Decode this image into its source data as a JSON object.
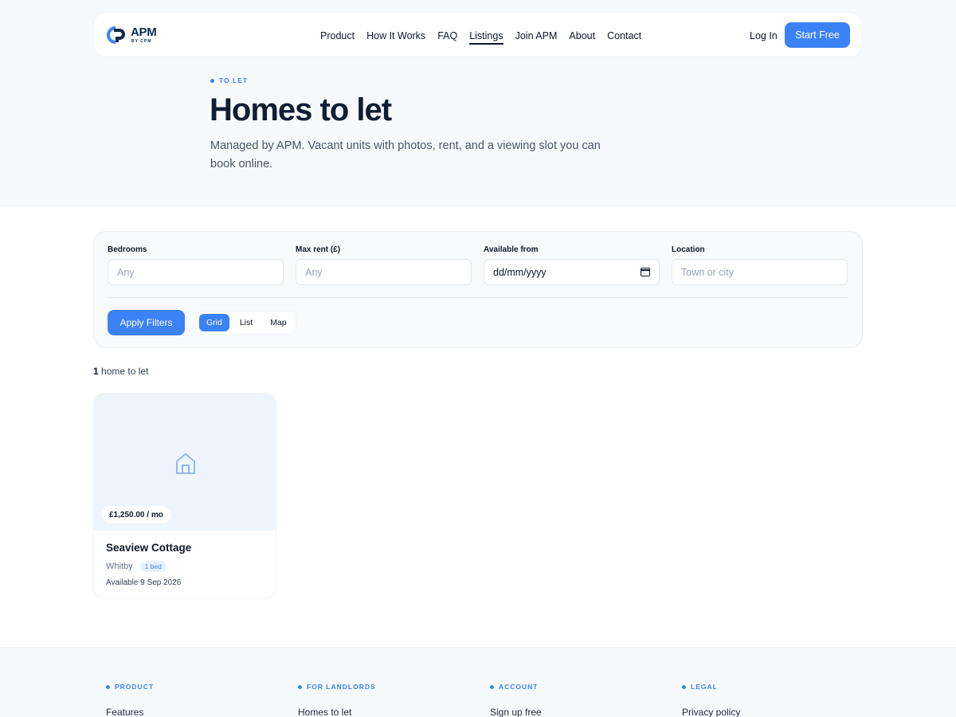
{
  "brand": {
    "name": "APM",
    "sub": "BY CPM",
    "colors": {
      "accent": "#3b82f6",
      "navy": "#0f2a4a"
    }
  },
  "nav": {
    "items": [
      {
        "label": "Product"
      },
      {
        "label": "How It Works"
      },
      {
        "label": "FAQ"
      },
      {
        "label": "Listings",
        "active": true
      },
      {
        "label": "Join APM"
      },
      {
        "label": "About"
      },
      {
        "label": "Contact"
      }
    ],
    "login": "Log In",
    "cta": "Start Free"
  },
  "hero": {
    "eyebrow": "TO LET",
    "title": "Homes to let",
    "subtitle": "Managed by APM. Vacant units with photos, rent, and a viewing slot you can book online."
  },
  "filters": {
    "bedrooms": {
      "label": "Bedrooms",
      "placeholder": "Any"
    },
    "max_rent": {
      "label": "Max rent (£)",
      "placeholder": "Any"
    },
    "available_from": {
      "label": "Available from",
      "value": "dd/mm/yyyy"
    },
    "location": {
      "label": "Location",
      "placeholder": "Town or city"
    },
    "apply": "Apply Filters",
    "views": [
      "Grid",
      "List",
      "Map"
    ],
    "active_view": "Grid"
  },
  "results": {
    "count": "1",
    "count_suffix": " home to let"
  },
  "listings": [
    {
      "price": "£1,250.00 / mo",
      "title": "Seaview Cottage",
      "town": "Whitby",
      "beds": "1 bed",
      "available": "Available 9 Sep 2026",
      "icon": "house-icon"
    }
  ],
  "footer": {
    "columns": [
      {
        "heading": "PRODUCT",
        "link": "Features"
      },
      {
        "heading": "FOR LANDLORDS",
        "link": "Homes to let"
      },
      {
        "heading": "ACCOUNT",
        "link": "Sign up free"
      },
      {
        "heading": "LEGAL",
        "link": "Privacy policy"
      }
    ]
  }
}
